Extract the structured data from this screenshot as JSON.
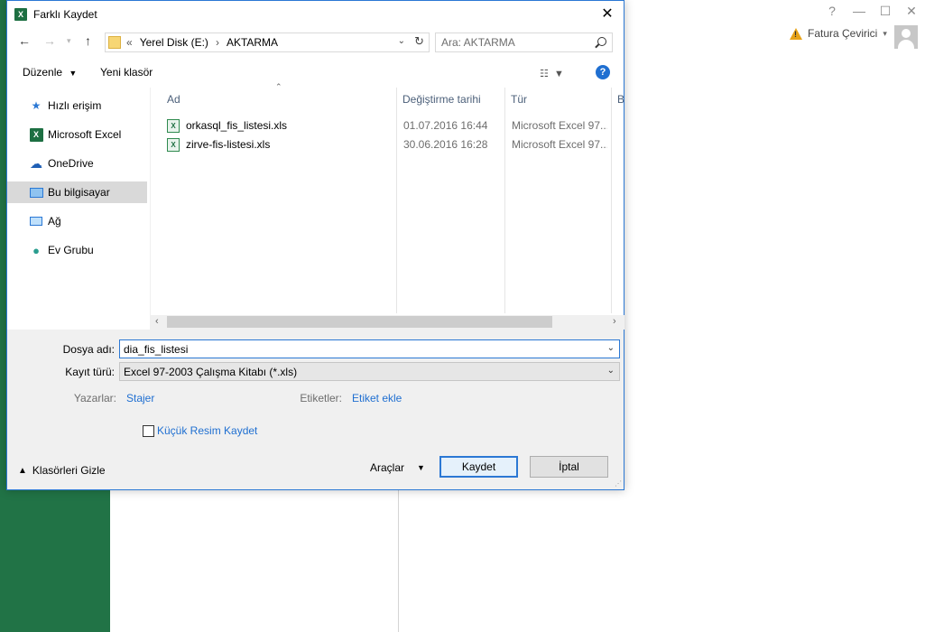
{
  "background": {
    "window_buttons": [
      "?",
      "—",
      "☐",
      "✕"
    ],
    "user_name": "Fatura Çevirici"
  },
  "dialog": {
    "title": "Farklı Kaydet",
    "address": {
      "prefix": "«",
      "segments": [
        "Yerel Disk (E:)",
        "›",
        "AKTARMA"
      ]
    },
    "search_placeholder": "Ara: AKTARMA",
    "toolbar": {
      "organize": "Düzenle",
      "new_folder": "Yeni klasör"
    },
    "nav": [
      {
        "label": "Hızlı erişim",
        "icon": "star-icon"
      },
      {
        "label": "Microsoft Excel",
        "icon": "excel-icon"
      },
      {
        "label": "OneDrive",
        "icon": "cloud-icon"
      },
      {
        "label": "Bu bilgisayar",
        "icon": "computer-icon",
        "selected": true
      },
      {
        "label": "Ağ",
        "icon": "network-icon"
      },
      {
        "label": "Ev Grubu",
        "icon": "homegroup-icon"
      }
    ],
    "columns": {
      "name": "Ad",
      "modified": "Değiştirme tarihi",
      "type": "Tür",
      "size": "B"
    },
    "files": [
      {
        "name": "orkasql_fis_listesi.xls",
        "modified": "01.07.2016 16:44",
        "type": "Microsoft Excel 97..."
      },
      {
        "name": "zirve-fis-listesi.xls",
        "modified": "30.06.2016 16:28",
        "type": "Microsoft Excel 97..."
      }
    ],
    "form": {
      "filename_label": "Dosya adı:",
      "filename_value": "dia_fis_listesi",
      "type_label": "Kayıt türü:",
      "type_value": "Excel 97-2003 Çalışma Kitabı (*.xls)",
      "authors_label": "Yazarlar:",
      "authors_value": "Stajer",
      "tags_label": "Etiketler:",
      "tags_value": "Etiket ekle",
      "thumbnail_label": "Küçük Resim Kaydet",
      "hide_folders": "Klasörleri Gizle",
      "tools": "Araçlar",
      "save": "Kaydet",
      "cancel": "İptal"
    }
  }
}
